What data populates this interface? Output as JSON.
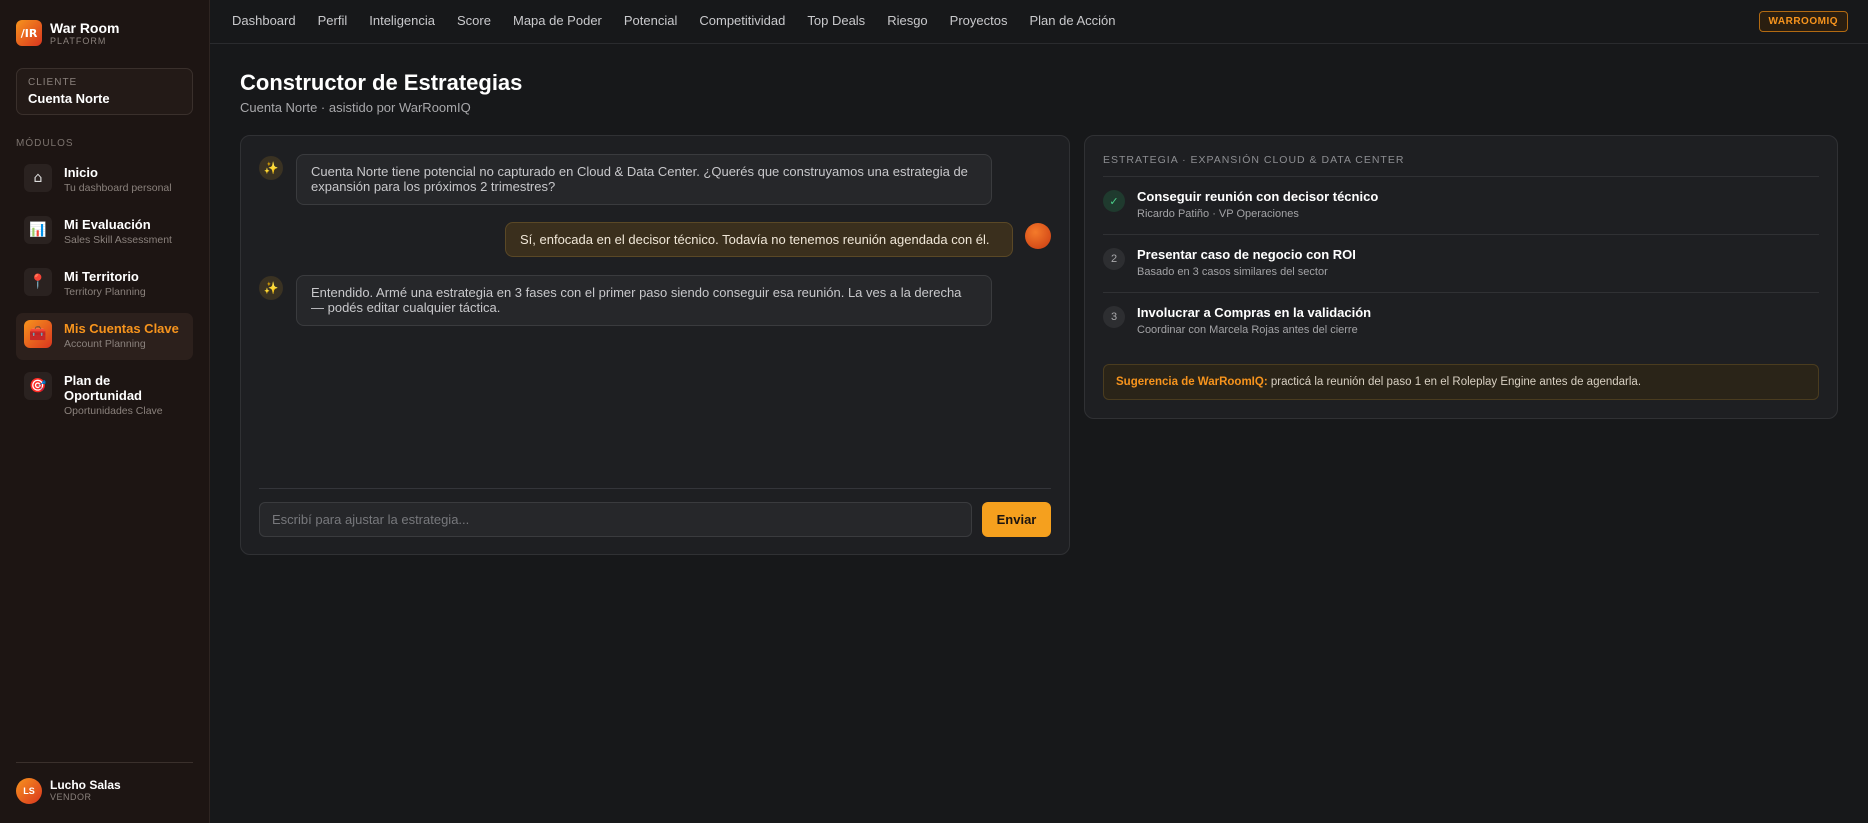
{
  "brand": {
    "logo": "/IR",
    "name": "War Room",
    "sub": "PLATFORM"
  },
  "client": {
    "label": "CLIENTE",
    "name": "Cuenta Norte"
  },
  "modules_label": "MÓDULOS",
  "sidebar": {
    "items": [
      {
        "title": "Inicio",
        "sub": "Tu dashboard personal",
        "icon": "⌂",
        "icon_name": "home-icon"
      },
      {
        "title": "Mi Evaluación",
        "sub": "Sales Skill Assessment",
        "icon": "📊",
        "icon_name": "chart-icon"
      },
      {
        "title": "Mi Territorio",
        "sub": "Territory Planning",
        "icon": "📍",
        "icon_name": "pin-icon"
      },
      {
        "title": "Mis Cuentas Clave",
        "sub": "Account Planning",
        "icon": "🧰",
        "icon_name": "briefcase-icon"
      },
      {
        "title": "Plan de Oportunidad",
        "sub": "Oportunidades Clave",
        "icon": "🎯",
        "icon_name": "target-icon"
      }
    ]
  },
  "user": {
    "initials": "LS",
    "name": "Lucho Salas",
    "role": "VENDOR"
  },
  "topnav": {
    "items": [
      "Dashboard",
      "Perfil",
      "Inteligencia",
      "Score",
      "Mapa de Poder",
      "Potencial",
      "Competitividad",
      "Top Deals",
      "Riesgo",
      "Proyectos",
      "Plan de Acción"
    ],
    "badge": "WARROOMIQ"
  },
  "page": {
    "title": "Constructor de Estrategias",
    "subtitle": "Cuenta Norte · asistido por WarRoomIQ"
  },
  "chat": {
    "messages": [
      {
        "from": "ai",
        "text": "Cuenta Norte tiene potencial no capturado en Cloud & Data Center. ¿Querés que construyamos una estrategia de expansión para los próximos 2 trimestres?"
      },
      {
        "from": "user",
        "text": "Sí, enfocada en el decisor técnico. Todavía no tenemos reunión agendada con él."
      },
      {
        "from": "ai",
        "text": "Entendido. Armé una estrategia en 3 fases con el primer paso siendo conseguir esa reunión. La ves a la derecha — podés editar cualquier táctica."
      }
    ],
    "input_placeholder": "Escribí para ajustar la estrategia...",
    "send_label": "Enviar"
  },
  "strategy": {
    "heading": "ESTRATEGIA · EXPANSIÓN CLOUD & DATA CENTER",
    "steps": [
      {
        "marker": "✓",
        "title": "Conseguir reunión con decisor técnico",
        "sub": "Ricardo Patiño · VP Operaciones",
        "done": true
      },
      {
        "marker": "2",
        "title": "Presentar caso de negocio con ROI",
        "sub": "Basado en 3 casos similares del sector",
        "done": false
      },
      {
        "marker": "3",
        "title": "Involucrar a Compras en la validación",
        "sub": "Coordinar con Marcela Rojas antes del cierre",
        "done": false
      }
    ],
    "suggestion_label": "Sugerencia de WarRoomIQ:",
    "suggestion_text": " practicá la reunión del paso 1 en el Roleplay Engine antes de agendarla."
  },
  "colors": {
    "accent": "#f7941d",
    "accent_dark": "#d9351f",
    "success": "#4bd08a",
    "background": "#17181a"
  }
}
